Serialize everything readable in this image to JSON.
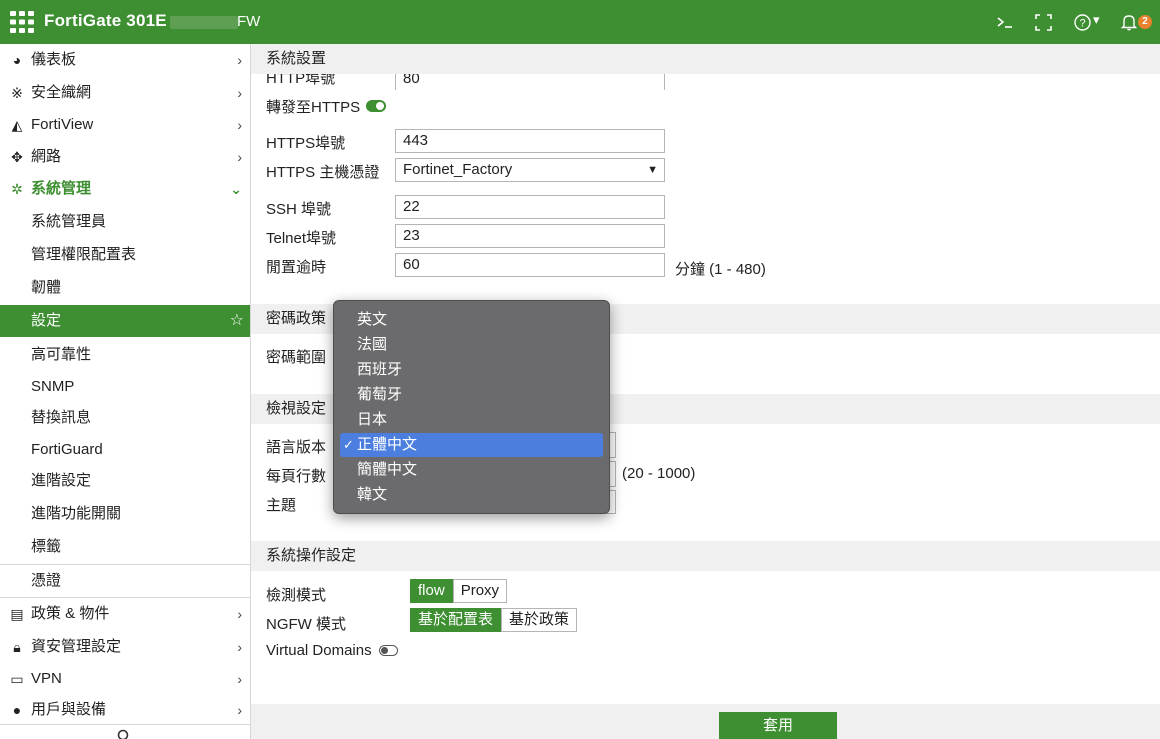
{
  "topbar": {
    "brand": "FortiGate 301E",
    "hostname_suffix": "FW",
    "icons": [
      "terminal-icon",
      "fullscreen-icon",
      "help-icon",
      "bell-icon"
    ],
    "help_arrow": "▾",
    "notification_count": "2",
    "color": "#3e8f32"
  },
  "sidebar": {
    "items": [
      {
        "icon": "dashboard-icon",
        "label": "儀表板"
      },
      {
        "icon": "security-fabric-icon",
        "label": "安全織網"
      },
      {
        "icon": "fortiview-icon",
        "label": "FortiView"
      },
      {
        "icon": "network-icon",
        "label": "網路"
      },
      {
        "icon": "gear-icon",
        "label": "系統管理"
      },
      {
        "label": "系統管理員"
      },
      {
        "label": "管理權限配置表"
      },
      {
        "label": "韌體"
      },
      {
        "label": "設定"
      },
      {
        "label": "高可靠性"
      },
      {
        "label": "SNMP"
      },
      {
        "label": "替換訊息"
      },
      {
        "label": "FortiGuard"
      },
      {
        "label": "進階設定"
      },
      {
        "label": "進階功能開關"
      },
      {
        "label": "標籤"
      },
      {
        "label": "憑證"
      },
      {
        "icon": "policy-icon",
        "label": "政策 & 物件"
      },
      {
        "icon": "lock-icon",
        "label": "資安管理設定"
      },
      {
        "icon": "laptop-icon",
        "label": "VPN"
      },
      {
        "icon": "user-icon",
        "label": "用戶與設備"
      }
    ]
  },
  "main": {
    "section_system": "系統設置",
    "http_port_label": "HTTP埠號",
    "http_port_value": "80",
    "redirect_https_label": "轉發至HTTPS",
    "https_port_label": "HTTPS埠號",
    "https_port_value": "443",
    "https_cert_label": "HTTPS 主機憑證",
    "https_cert_value": "Fortinet_Factory",
    "ssh_port_label": "SSH 埠號",
    "ssh_port_value": "22",
    "telnet_port_label": "Telnet埠號",
    "telnet_port_value": "23",
    "idle_timeout_label": "閒置逾時",
    "idle_timeout_value": "60",
    "idle_timeout_hint": "分鐘 (1 - 480)",
    "section_password": "密碼政策",
    "password_scope_label": "密碼範圍",
    "section_view": "檢視設定",
    "language_label": "語言版本",
    "rows_per_page_label": "每頁行數",
    "rows_per_page_hint": "(20 - 1000)",
    "theme_label": "主題",
    "section_operation": "系統操作設定",
    "inspection_mode_label": "檢測模式",
    "inspection_options": [
      "flow",
      "Proxy"
    ],
    "inspection_selected": "flow",
    "ngfw_mode_label": "NGFW 模式",
    "ngfw_options": [
      "基於配置表",
      "基於政策"
    ],
    "ngfw_selected": "基於配置表",
    "virtual_domains_label": "Virtual Domains",
    "apply_button": "套用"
  },
  "language_dropdown": {
    "options": [
      "英文",
      "法國",
      "西班牙",
      "葡萄牙",
      "日本",
      "正體中文",
      "簡體中文",
      "韓文"
    ],
    "selected": "正體中文",
    "check": "✓"
  }
}
